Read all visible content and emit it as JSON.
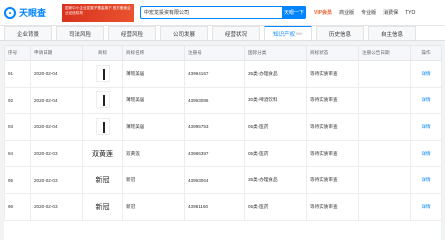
{
  "header": {
    "logo_text": "天眼查",
    "banner_text": "国家中小企业发展子基金旗下 官方备案企业征信机构",
    "search_value": "中宏龙投资有限公司",
    "search_button": "天眼一下",
    "nav": [
      "VIP会员",
      "商业版",
      "专业版",
      "消费保",
      "TYO"
    ]
  },
  "tabs": [
    {
      "label": "企业背景",
      "count": "",
      "active": false
    },
    {
      "label": "司法风险",
      "count": "",
      "active": false
    },
    {
      "label": "经营风险",
      "count": "",
      "active": false
    },
    {
      "label": "公司发展",
      "count": "",
      "active": false
    },
    {
      "label": "经营状况",
      "count": "",
      "active": false
    },
    {
      "label": "知识产权",
      "count": "99+",
      "active": true
    },
    {
      "label": "历史信息",
      "count": "",
      "active": false
    },
    {
      "label": "自主信息",
      "count": "",
      "active": false
    }
  ],
  "table": {
    "columns": [
      "序号",
      "申请日期",
      "商标",
      "商标名称",
      "注册号",
      "国际分类",
      "商标状态",
      "注册公告日期",
      "操作"
    ],
    "rows": [
      {
        "idx": "91",
        "date": "2020-02-04",
        "mark": "stroke",
        "name": "薄瑶美居",
        "reg": "43994167",
        "class": "35类-办理食品",
        "status": "等待实质审查",
        "pub": "",
        "op": "详情"
      },
      {
        "idx": "92",
        "date": "2020-02-04",
        "mark": "stroke",
        "name": "薄瑶美居",
        "reg": "43993086",
        "class": "30类-啤酒饮料",
        "status": "等待实质审查",
        "pub": "",
        "op": "详情"
      },
      {
        "idx": "93",
        "date": "2020-02-04",
        "mark": "stroke",
        "name": "薄瑶美居",
        "reg": "43995753",
        "class": "05类-医药",
        "status": "等待实质审查",
        "pub": "",
        "op": "详情"
      },
      {
        "idx": "94",
        "date": "2020-02-03",
        "mark": "text",
        "mark_text": "双黄莲",
        "name": "双黄莲",
        "reg": "43986397",
        "class": "05类-医药",
        "status": "等待实质审查",
        "pub": "",
        "op": "详情"
      },
      {
        "idx": "95",
        "date": "2020-02-03",
        "mark": "text",
        "mark_text": "新冠",
        "name": "新冠",
        "reg": "43993064",
        "class": "35类-办理食品",
        "status": "等待实质审查",
        "pub": "",
        "op": "详情"
      },
      {
        "idx": "96",
        "date": "2020-02-03",
        "mark": "text",
        "mark_text": "新冠",
        "name": "新冠",
        "reg": "43981160",
        "class": "05类-医药",
        "status": "等待实质审查",
        "pub": "",
        "op": "详情"
      }
    ]
  }
}
